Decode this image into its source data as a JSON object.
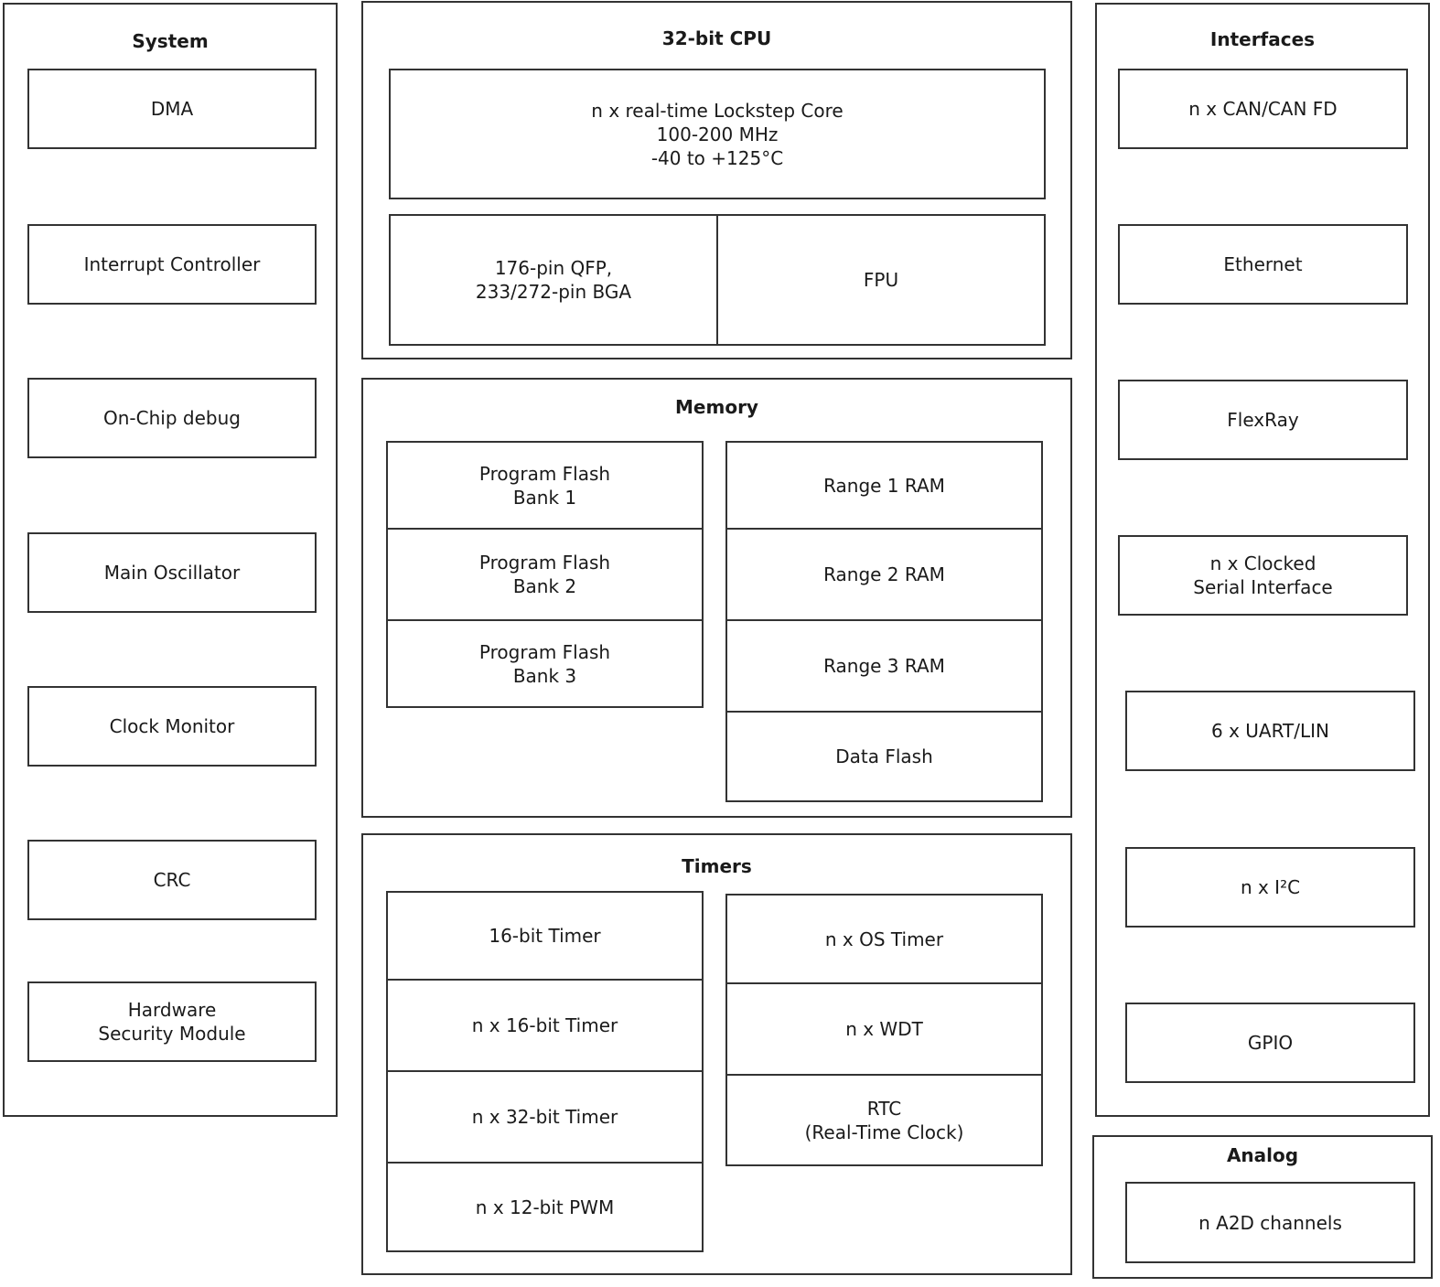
{
  "system": {
    "title": "System",
    "items": [
      "DMA",
      "Interrupt Controller",
      "On-Chip debug",
      "Main Oscillator",
      "Clock Monitor",
      "CRC",
      "Hardware\nSecurity Module"
    ]
  },
  "cpu": {
    "title": "32-bit CPU",
    "core": "n x real-time Lockstep Core\n100-200 MHz\n-40 to +125°C",
    "package": "176-pin QFP,\n233/272-pin BGA",
    "fpu": "FPU"
  },
  "memory": {
    "title": "Memory",
    "flash": [
      "Program Flash\nBank 1",
      "Program Flash\nBank 2",
      "Program Flash\nBank 3"
    ],
    "ram": [
      "Range 1 RAM",
      "Range 2 RAM",
      "Range 3 RAM",
      "Data Flash"
    ]
  },
  "timers": {
    "title": "Timers",
    "left": [
      "16-bit Timer",
      "n x 16-bit Timer",
      "n x 32-bit Timer",
      "n x 12-bit PWM"
    ],
    "right": [
      "n x OS Timer",
      "n x  WDT",
      "RTC\n(Real-Time Clock)"
    ]
  },
  "interfaces": {
    "title": "Interfaces",
    "items": [
      "n x CAN/CAN FD",
      "Ethernet",
      "FlexRay",
      "n x Clocked\nSerial Interface",
      "6 x UART/LIN",
      "n x I²C",
      "GPIO"
    ]
  },
  "analog": {
    "title": "Analog",
    "items": [
      "n A2D channels"
    ]
  }
}
